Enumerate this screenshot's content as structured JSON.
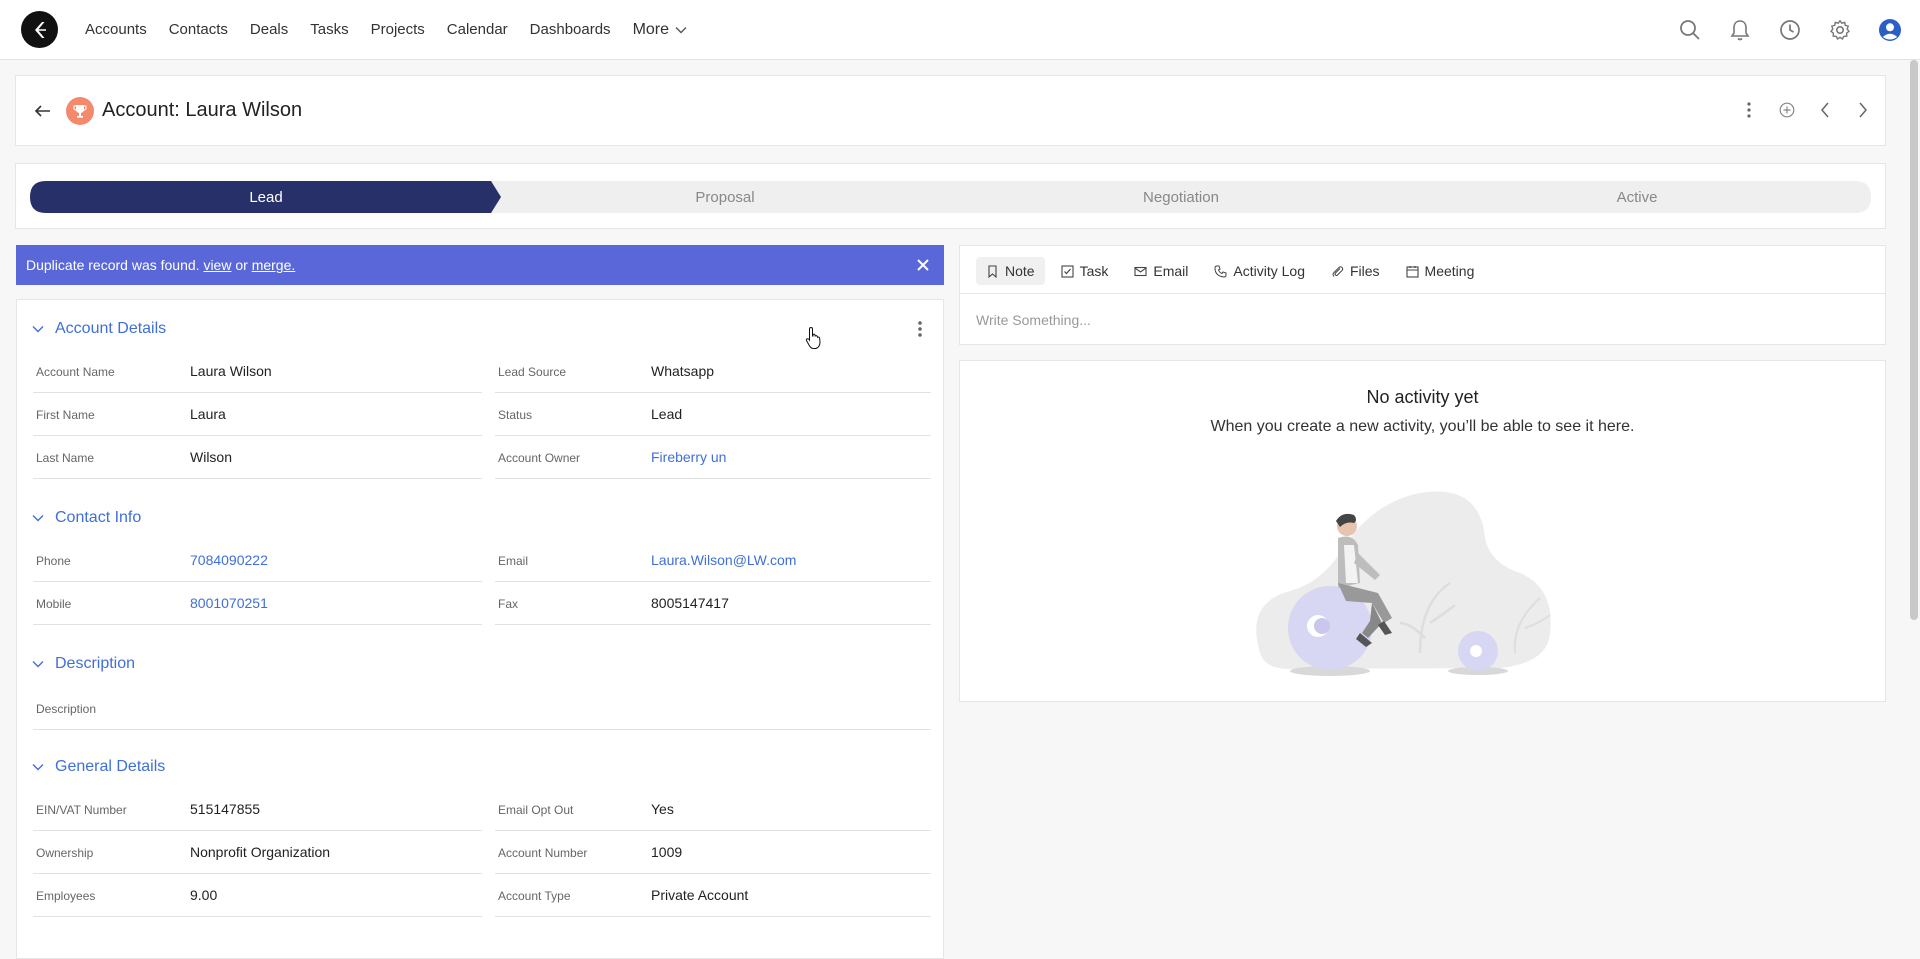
{
  "nav": {
    "links": [
      "Accounts",
      "Contacts",
      "Deals",
      "Tasks",
      "Projects",
      "Calendar",
      "Dashboards"
    ],
    "more_label": "More"
  },
  "record": {
    "title": "Account: Laura Wilson"
  },
  "pipeline": {
    "stages": [
      "Lead",
      "Proposal",
      "Negotiation",
      "Active"
    ],
    "active_stage": "Lead",
    "active_color": "#28306a",
    "inactive_color": "#f0f0f0"
  },
  "duplicate_banner": {
    "text": "Duplicate record was found.",
    "view_link": "view",
    "or_text": "or",
    "merge_link": "merge.",
    "color": "#5a67d8"
  },
  "sections": {
    "account_details": "Account Details",
    "contact_info": "Contact Info",
    "description": "Description",
    "general_details": "General Details"
  },
  "fields": {
    "account_name": {
      "label": "Account Name",
      "value": "Laura Wilson"
    },
    "lead_source": {
      "label": "Lead Source",
      "value": "Whatsapp"
    },
    "first_name": {
      "label": "First Name",
      "value": "Laura"
    },
    "status": {
      "label": "Status",
      "value": "Lead"
    },
    "last_name": {
      "label": "Last Name",
      "value": "Wilson"
    },
    "account_owner": {
      "label": "Account Owner",
      "value": "Fireberry un"
    },
    "phone": {
      "label": "Phone",
      "value": "7084090222"
    },
    "email": {
      "label": "Email",
      "value": "Laura.Wilson@LW.com"
    },
    "mobile": {
      "label": "Mobile",
      "value": "8001070251"
    },
    "fax": {
      "label": "Fax",
      "value": "8005147417"
    },
    "description": {
      "label": "Description",
      "value": ""
    },
    "ein_vat": {
      "label": "EIN/VAT Number",
      "value": "515147855"
    },
    "email_opt_out": {
      "label": "Email Opt Out",
      "value": "Yes"
    },
    "ownership": {
      "label": "Ownership",
      "value": "Nonprofit Organization"
    },
    "account_number": {
      "label": "Account Number",
      "value": "1009"
    },
    "employees": {
      "label": "Employees",
      "value": "9.00"
    },
    "account_type": {
      "label": "Account Type",
      "value": "Private Account"
    }
  },
  "composer": {
    "tabs": [
      "Note",
      "Task",
      "Email",
      "Activity Log",
      "Files",
      "Meeting"
    ],
    "active_tab": "Note",
    "placeholder": "Write Something..."
  },
  "activity": {
    "empty_title": "No activity yet",
    "empty_subtitle": "When you create a new activity, you’ll be able to see it here."
  },
  "icons": {
    "logo": "fireberry-logo",
    "nav": [
      "search-icon",
      "bell-icon",
      "clock-icon",
      "gear-icon",
      "user-icon"
    ],
    "record_actions": [
      "kebab-icon",
      "add-circle-icon",
      "chevron-left-icon",
      "chevron-right-icon"
    ]
  },
  "accent_color": "#3f6fd8"
}
